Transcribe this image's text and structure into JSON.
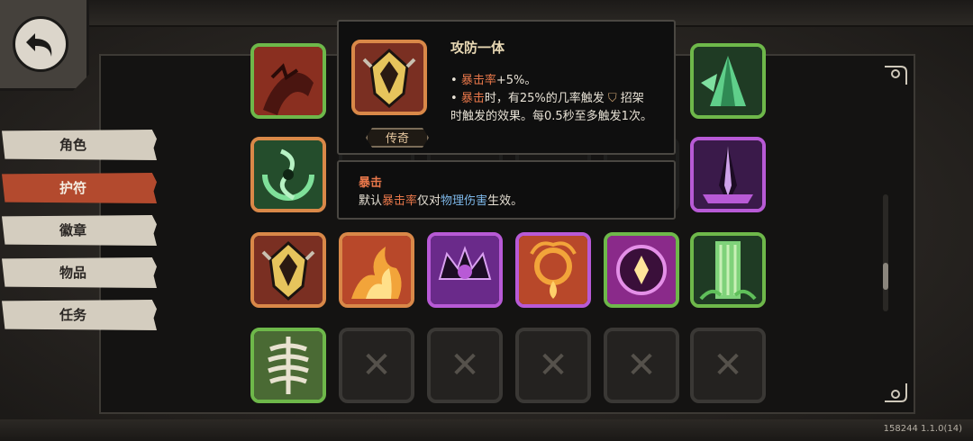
{
  "nav": {
    "back_icon": "back-arrow-icon",
    "tabs": [
      {
        "label": "角色",
        "active": false
      },
      {
        "label": "护符",
        "active": true
      },
      {
        "label": "徽章",
        "active": false
      },
      {
        "label": "物品",
        "active": false
      },
      {
        "label": "任务",
        "active": false
      }
    ]
  },
  "tooltip": {
    "title": "攻防一体",
    "bullet1_a": "暴击率",
    "bullet1_b": "+5%。",
    "bullet2_a": "暴击",
    "bullet2_b": "时，有25%的几率触发",
    "bullet2_c": "招架",
    "line3": "时触发的效果。每0.5秒至多触发1次。",
    "rarity": "传奇",
    "icon": "helmet-icon"
  },
  "keyword_tip": {
    "name": "暴击",
    "desc_a": "默认",
    "desc_b": "暴击率",
    "desc_c": "仅对",
    "desc_d": "物理伤害",
    "desc_e": "生效。"
  },
  "grid": {
    "row1": [
      "claw-charm-icon",
      "hidden",
      "hidden",
      "hidden",
      "hidden",
      "jade-crystal-icon"
    ],
    "row2": [
      "wind-swirl-icon",
      "hidden",
      "hidden",
      "hidden",
      "hidden",
      "purple-blade-icon"
    ],
    "row3": [
      "golden-helmet-icon",
      "flame-icon",
      "crown-icon",
      "fire-ring-icon",
      "magic-gem-icon",
      "vine-waterfall-icon"
    ],
    "row4": [
      "bone-ribcage-icon",
      "empty-slot",
      "empty-slot",
      "empty-slot",
      "empty-slot",
      "empty-slot"
    ]
  },
  "colors": {
    "accent": "#b34a2e",
    "highlight": "#e8774a",
    "legendary": "#d98848"
  },
  "version": "158244 1.1.0(14)"
}
